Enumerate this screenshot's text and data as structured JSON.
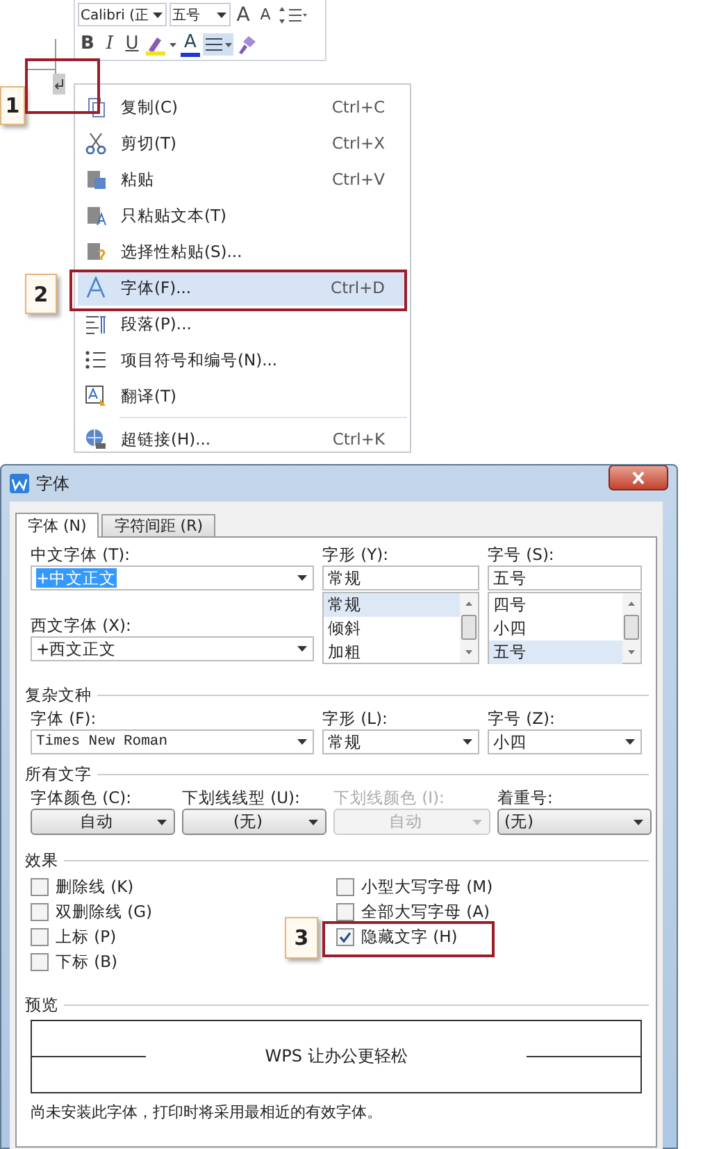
{
  "mini_toolbar": {
    "font": "Calibri (正",
    "size": "五号",
    "size_buttons": [
      {
        "kind": "grow",
        "label": "A"
      },
      {
        "kind": "shrink",
        "label": "A"
      },
      {
        "kind": "spacing"
      }
    ],
    "format_buttons": [
      {
        "kind": "bold",
        "label": "B"
      },
      {
        "kind": "italic",
        "label": "I"
      },
      {
        "kind": "underline",
        "label": "U"
      },
      {
        "kind": "highlight"
      },
      {
        "kind": "font_color",
        "label": "A"
      },
      {
        "kind": "align",
        "selected": true
      },
      {
        "kind": "painter"
      }
    ]
  },
  "context_menu": {
    "items": [
      {
        "label": "复制(C)",
        "shortcut": "Ctrl+C",
        "selected": false
      },
      {
        "label": "剪切(T)",
        "shortcut": "Ctrl+X",
        "selected": false
      },
      {
        "label": "粘贴",
        "shortcut": "Ctrl+V",
        "selected": false
      },
      {
        "label": "只粘贴文本(T)",
        "selected": false
      },
      {
        "label": "选择性粘贴(S)...",
        "selected": false
      },
      {
        "label": "字体(F)...",
        "shortcut": "Ctrl+D",
        "selected": true
      },
      {
        "label": "段落(P)...",
        "selected": false
      },
      {
        "label": "项目符号和编号(N)...",
        "selected": false
      },
      {
        "label": "翻译(T)",
        "selected": false
      },
      {
        "label": "超链接(H)...",
        "shortcut": "Ctrl+K",
        "selected": false,
        "separator_before": true
      }
    ]
  },
  "callouts": [
    {
      "label": "1"
    },
    {
      "label": "2"
    },
    {
      "label": "3"
    }
  ],
  "dialog": {
    "title": "字体",
    "tabs": [
      {
        "label": "字体 (N)",
        "selected": true
      },
      {
        "label": "字符间距 (R)",
        "selected": false
      }
    ],
    "chinese_font": {
      "label": "中文字体 (T):",
      "value": "+中文正文",
      "value_selected": true
    },
    "western_font": {
      "label": "西文字体 (X):",
      "value": "+西文正文",
      "value_selected": false
    },
    "style": {
      "label": "字形 (Y):",
      "value": "常规",
      "options": [
        {
          "label": "常规",
          "selected": true
        },
        {
          "label": "倾斜",
          "selected": false
        },
        {
          "label": "加粗",
          "selected": false
        }
      ]
    },
    "size": {
      "label": "字号 (S):",
      "value": "五号",
      "options": [
        {
          "label": "四号",
          "selected": false
        },
        {
          "label": "小四",
          "selected": false
        },
        {
          "label": "五号",
          "selected": true
        }
      ]
    },
    "complex_script": {
      "title": "复杂文种",
      "fields": [
        {
          "label": "字体 (F):",
          "value": "Times New Roman",
          "kind": "mono"
        },
        {
          "label": "字形 (L):",
          "value": "常规",
          "kind": "plain"
        },
        {
          "label": "字号 (Z):",
          "value": "小四",
          "kind": "plain"
        }
      ]
    },
    "all_text": {
      "title": "所有文字",
      "fields": [
        {
          "label": "字体颜色 (C):",
          "value": "自动",
          "kind": "button",
          "disabled": false
        },
        {
          "label": "下划线线型 (U):",
          "value": "(无)",
          "kind": "button",
          "disabled": false
        },
        {
          "label": "下划线颜色 (I):",
          "value": "自动",
          "kind": "button",
          "disabled": true
        },
        {
          "label": "着重号:",
          "value": "(无)",
          "kind": "dropdown",
          "disabled": false
        }
      ]
    },
    "effects": {
      "title": "效果",
      "columns": [
        [
          {
            "label": "删除线 (K)",
            "checked": false
          },
          {
            "label": "双删除线 (G)",
            "checked": false
          },
          {
            "label": "上标 (P)",
            "checked": false
          },
          {
            "label": "下标 (B)",
            "checked": false
          }
        ],
        [
          {
            "label": "小型大写字母 (M)",
            "checked": false
          },
          {
            "label": "全部大写字母 (A)",
            "checked": false
          },
          {
            "label": "隐藏文字 (H)",
            "checked": true
          }
        ]
      ]
    },
    "preview": {
      "title": "预览",
      "sample": "WPS 让办公更轻松",
      "note": "尚未安装此字体，打印时将采用最相近的有效字体。"
    }
  }
}
